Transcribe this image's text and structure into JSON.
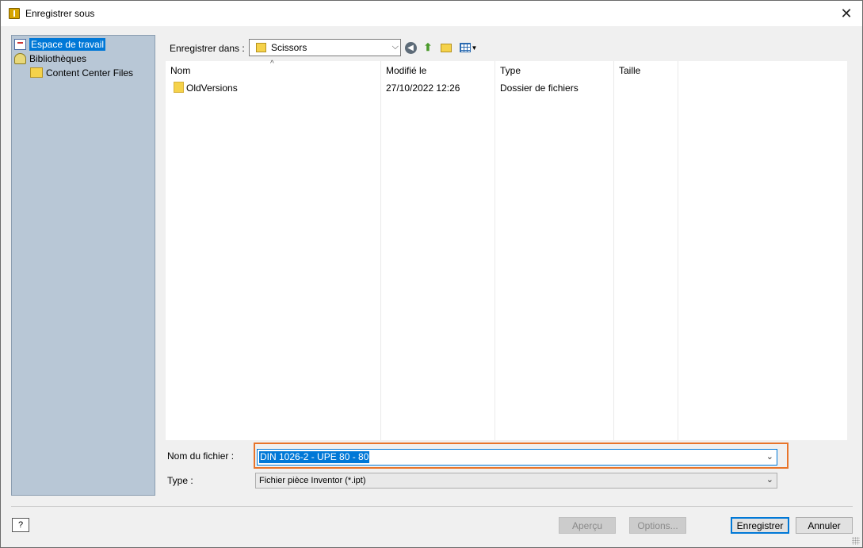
{
  "window": {
    "title": "Enregistrer sous",
    "close_glyph": "✕"
  },
  "sidebar": {
    "items": [
      {
        "label": "Espace de travail",
        "icon": "workspace-icon",
        "selected": true
      },
      {
        "label": "Bibliothèques",
        "icon": "libraries-icon",
        "selected": false
      },
      {
        "label": "Content Center Files",
        "icon": "folder-icon",
        "selected": false
      }
    ]
  },
  "toolbar": {
    "save_in_label": "Enregistrer dans :",
    "current_folder": "Scissors",
    "icons": [
      "back-icon",
      "up-folder-icon",
      "new-folder-icon",
      "views-menu-icon"
    ]
  },
  "file_list": {
    "columns": [
      "Nom",
      "Modifié le",
      "Type",
      "Taille"
    ],
    "sort_indicator": "^",
    "rows": [
      {
        "name": "OldVersions",
        "modified": "27/10/2022 12:26",
        "type": "Dossier de fichiers",
        "size": ""
      }
    ]
  },
  "form": {
    "filename_label": "Nom du fichier :",
    "filename_value": "DIN 1026-2 - UPE 80 - 80",
    "type_label": "Type :",
    "type_value": "Fichier pièce Inventor (*.ipt)",
    "highlight_color": "#e8742a"
  },
  "buttons": {
    "help": "?",
    "preview": "Aperçu",
    "options": "Options...",
    "save": "Enregistrer",
    "cancel": "Annuler"
  },
  "colors": {
    "sidebar_bg": "#b8c7d6",
    "selection": "#0078d7"
  }
}
